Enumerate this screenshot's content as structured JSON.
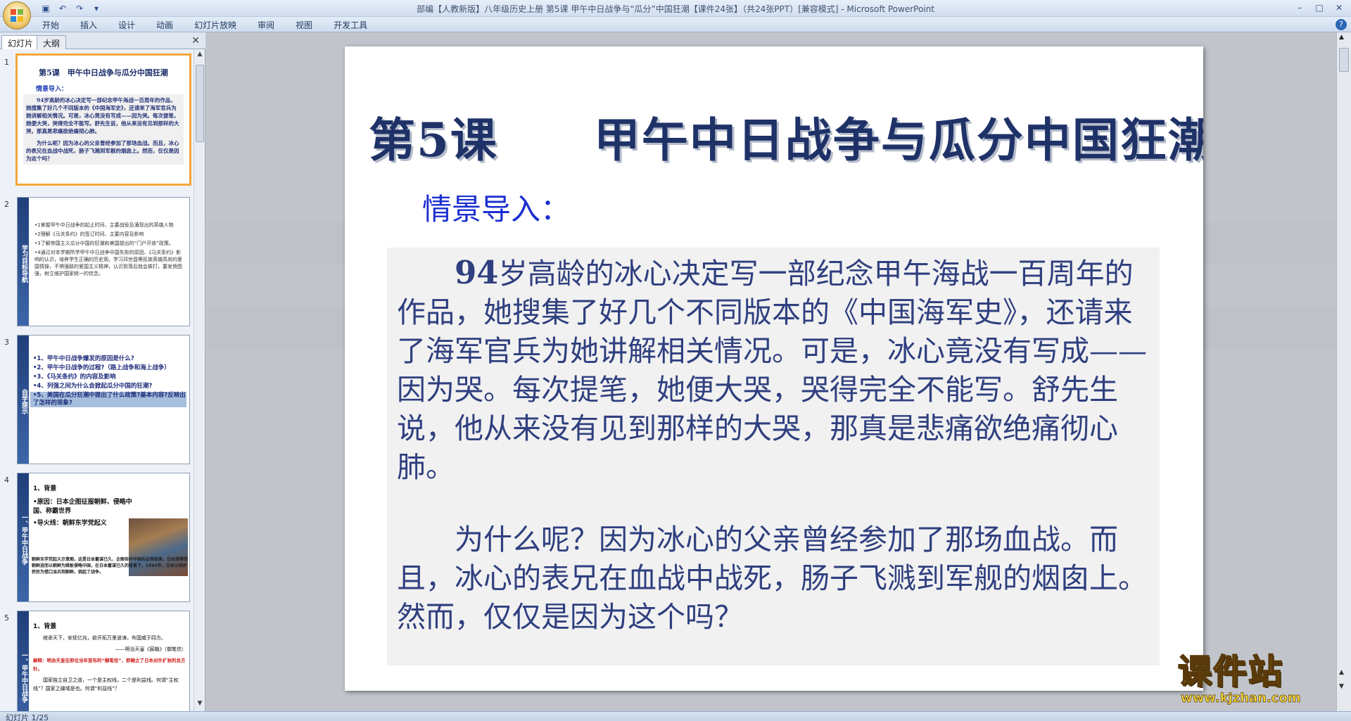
{
  "window": {
    "title": "部编【人教新版】八年级历史上册 第5课 甲午中日战争与“瓜分”中国狂潮【课件24张】（共24张PPT）[兼容模式] - Microsoft PowerPoint",
    "controls": [
      "–",
      "□",
      "✕"
    ]
  },
  "ribbon": {
    "tabs": [
      "开始",
      "插入",
      "设计",
      "动画",
      "幻灯片放映",
      "审阅",
      "视图",
      "开发工具"
    ]
  },
  "panel": {
    "tab_slides": "幻灯片",
    "tab_outline": "大纲",
    "close": "✕"
  },
  "thumbs": {
    "t1": {
      "num": "1",
      "title": "第5课　甲午中日战争与瓜分中国狂潮",
      "sub": "情景导入：",
      "p1": "94岁高龄的冰心决定写一部纪念甲午海战一百周年的作品，她搜集了好几个不同版本的《中国海军史》，还请来了海军官兵为她讲解相关情况。可是，冰心竟没有写成——因为哭。每次提笔，她便大哭，哭得完全不能写。舒先生说，他从来没有见到那样的大哭，那真是悲痛欲绝痛彻心肺。",
      "p2": "为什么呢？因为冰心的父亲曾经参加了那场血战。而且，冰心的表兄在血战中战死，肠子飞溅到军舰的烟囱上。然而，仅仅是因为这个吗？"
    },
    "t2": {
      "num": "2",
      "band": "学习目标导航",
      "items": [
        "•1掌握甲午中日战争的起止时间、主要战役及涌现出的英雄人物",
        "•2理解《马关条约》的签订时间、主要内容及影响",
        "•3了解帝国主义瓜分中国的狂潮和美国提出的“门户开放”政策。",
        "•4通过对本学期所学甲午中日战争中国失败的原因、《马关条约》影响的认识，培养学生正确的历史观，学习邓世昌等民族英雄高尚的爱国情操，不惧强敌的爱国主义精神，认识到落后就会挨打，要发愤图强，树立维护国家统一的信念。"
      ]
    },
    "t3": {
      "num": "3",
      "band": "自学提示",
      "items": [
        "•1、甲午中日战争爆发的原因是什么?",
        "•2、甲午中日战争的过程?（路上战争和海上战争）",
        "•3、《马关条约》的内容及影响",
        "•4、列强之间为什么会掀起瓜分中国的狂潮?",
        "•5、美国在瓜分狂潮中提出了什么政策?基本内容?反映出了怎样的现象?"
      ]
    },
    "t4": {
      "num": "4",
      "band": "一、甲午中日战争",
      "heading": "1、背景",
      "l1": "•原因：日本企图征服朝鲜、侵略中国、称霸世界",
      "l2": "•导火线：朝鲜东学党起义",
      "small": "朝鲜东学党起义示意图，这是日本蓄谋已久、企图吞并中国的必然结果，日本想得到朝鲜进而以朝鲜为跳板侵略中国，在日本蓄谋已久的背景下，1894年，日本以保护侨民为借口派兵到朝鲜，挑起了战争。"
    },
    "t5": {
      "num": "5",
      "band": "一、甲午中日战争",
      "heading": "1、背景",
      "quote": "继承天下，安抚亿兆，欲开拓万里波涛，布国威于四方。",
      "source": "——明治天皇《宸翰》（御笔信）",
      "red": "解释：明治天皇在即位当年宣布的“御笔信”，即确立了日本对外扩张的总方针。",
      "more": "国家独立自卫之道，一个是主权线，二个是利益线。何谓“主权线”？国家之疆域是也。何谓“利益线”？"
    }
  },
  "slide": {
    "title": "第5课　　甲午中日战争与瓜分中国狂潮",
    "subtitle": "情景导入：",
    "para1_lead": "94",
    "para1_rest": "岁高龄的冰心决定写一部纪念甲午海战一百周年的作品，她搜集了好几个不同版本的《中国海军史》，还请来了海军官兵为她讲解相关情况。可是，冰心竟没有写成——因为哭。每次提笔，她便大哭，哭得完全不能写。舒先生说，他从来没有见到那样的大哭，那真是悲痛欲绝痛彻心肺。",
    "para2": "为什么呢？因为冰心的父亲曾经参加了那场血战。而且，冰心的表兄在血战中战死，肠子飞溅到军舰的烟囱上。然而，仅仅是因为这个吗？"
  },
  "watermark": {
    "cn": "课件站",
    "url": "www.kjzhan.com"
  },
  "status": {
    "slide_indicator": "幻灯片 1/25"
  },
  "icons": {
    "save": "save-icon",
    "undo": "undo-icon",
    "redo": "redo-icon",
    "help": "help-icon"
  }
}
